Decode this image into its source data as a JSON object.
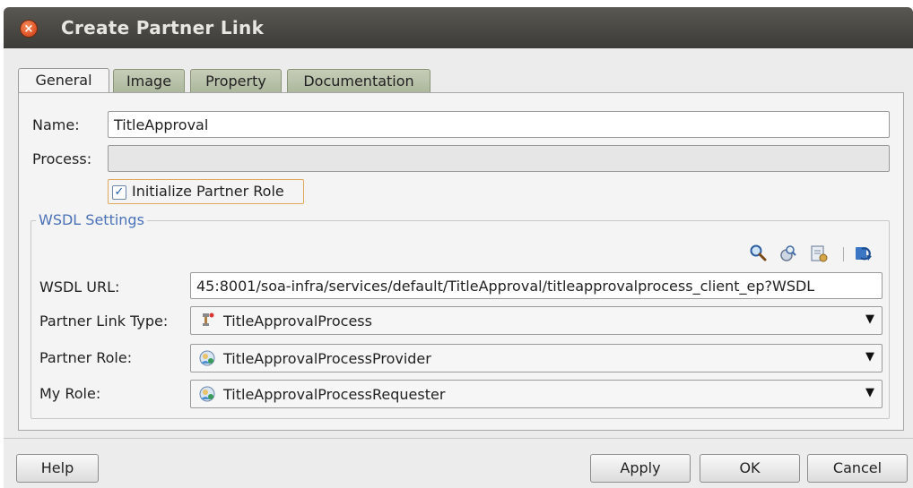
{
  "window": {
    "title": "Create Partner Link",
    "close_glyph": "×"
  },
  "tabs": [
    {
      "label": "General",
      "active": true
    },
    {
      "label": "Image",
      "active": false
    },
    {
      "label": "Property",
      "active": false
    },
    {
      "label": "Documentation",
      "active": false
    }
  ],
  "general": {
    "name_label": "Name:",
    "name_value": "TitleApproval",
    "process_label": "Process:",
    "process_value": "",
    "init_role_label": "Initialize Partner Role",
    "init_role_checked": true
  },
  "wsdl": {
    "group_title": "WSDL Settings",
    "toolbar_icons": [
      "search-icon",
      "browse-services-icon",
      "service-explorer-icon",
      "refresh-icon"
    ],
    "url_label": "WSDL URL:",
    "url_value": "45:8001/soa-infra/services/default/TitleApproval/titleapprovalprocess_client_ep?WSDL",
    "plt_label": "Partner Link Type:",
    "plt_value": "TitleApprovalProcess",
    "partner_role_label": "Partner Role:",
    "partner_role_value": "TitleApprovalProcessProvider",
    "my_role_label": "My Role:",
    "my_role_value": "TitleApprovalProcessRequester"
  },
  "buttons": {
    "help": "Help",
    "apply": "Apply",
    "ok": "OK",
    "cancel": "Cancel"
  },
  "colors": {
    "titlebar": "#3d3b37",
    "group_title": "#4a72b8",
    "focus_border": "#e0a85b"
  }
}
